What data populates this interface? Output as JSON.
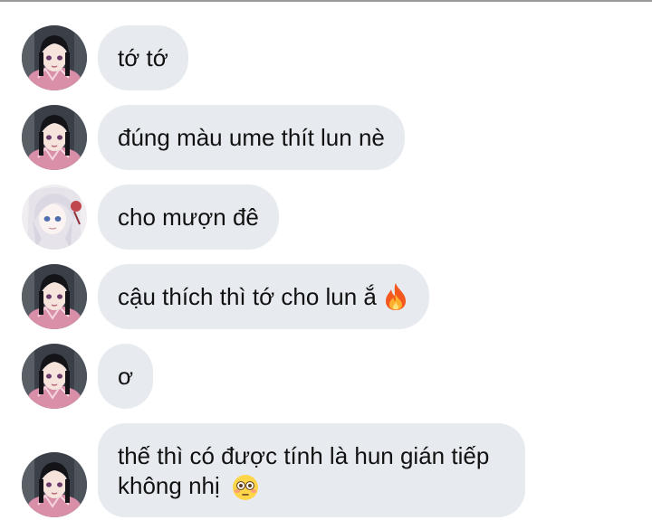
{
  "messages": [
    {
      "sender": "friend",
      "text": "tớ tớ",
      "emoji": null
    },
    {
      "sender": "friend",
      "text": "đúng màu ume thít lun nè",
      "emoji": null
    },
    {
      "sender": "me",
      "text": "cho mượn đê",
      "emoji": null
    },
    {
      "sender": "friend",
      "text": "cậu thích thì tớ cho lun ắ",
      "emoji": "fire-emoji"
    },
    {
      "sender": "friend",
      "text": "ơ",
      "emoji": null
    },
    {
      "sender": "friend",
      "text": "thế thì có được tính là hun gián tiếp không nhị",
      "emoji": "flushed-face-emoji"
    }
  ],
  "colors": {
    "bubble": "#e7ebf0",
    "text": "#111111",
    "background": "#ffffff"
  }
}
